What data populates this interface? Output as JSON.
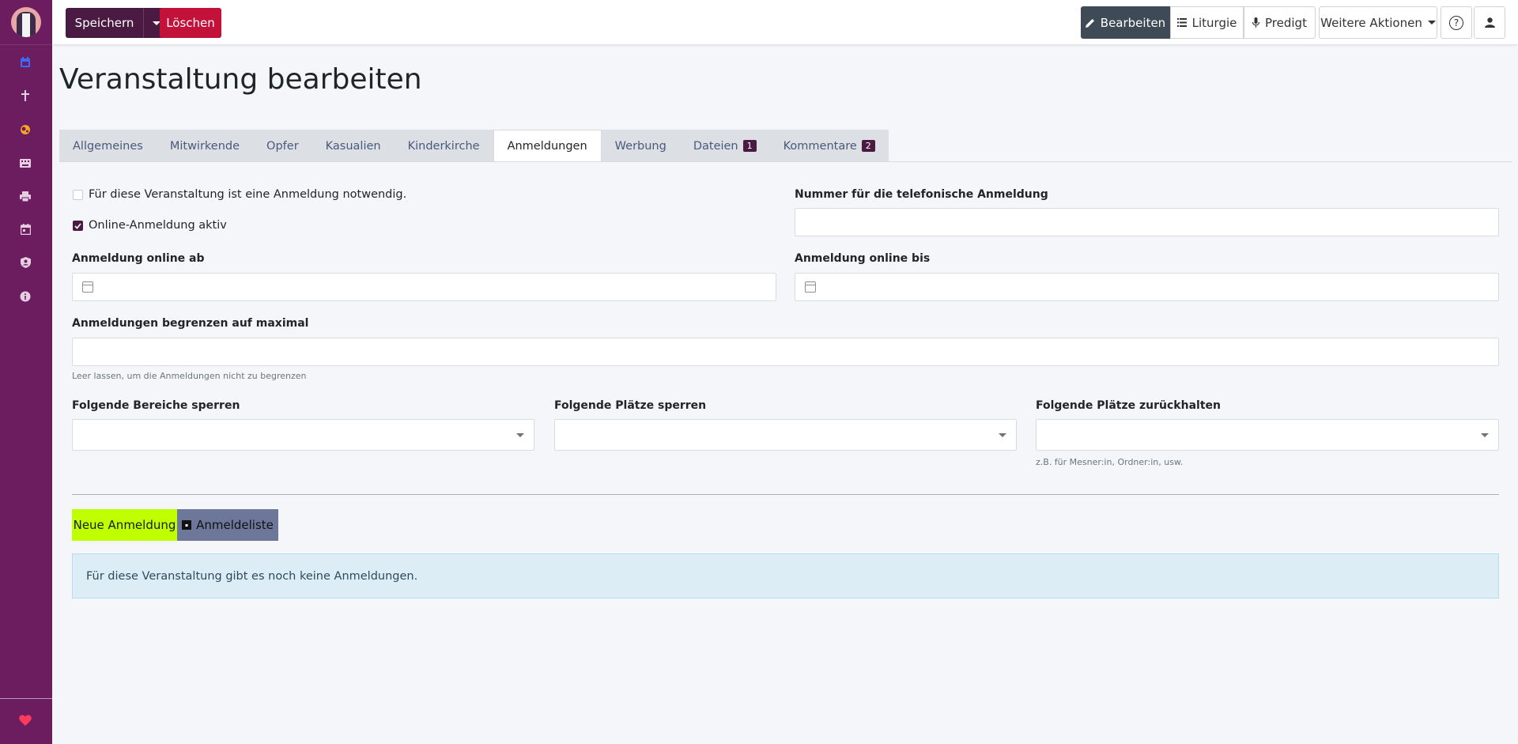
{
  "toolbar": {
    "save_label": "Speichern",
    "delete_label": "Löschen",
    "edit_label": "Bearbeiten",
    "liturgy_label": "Liturgie",
    "sermon_label": "Predigt",
    "more_label": "Weitere Aktionen"
  },
  "sidebar": {
    "icons": [
      "calendar-icon",
      "cross-icon",
      "globe-icon",
      "keyboard-icon",
      "print-icon",
      "calendar-day-icon",
      "user-shield-icon",
      "info-icon"
    ],
    "accent_color": "#6b1d5f",
    "footer_icon": "heart-icon"
  },
  "page": {
    "title": "Veranstaltung bearbeiten"
  },
  "tabs": [
    {
      "label": "Allgemeines"
    },
    {
      "label": "Mitwirkende"
    },
    {
      "label": "Opfer"
    },
    {
      "label": "Kasualien"
    },
    {
      "label": "Kinderkirche"
    },
    {
      "label": "Anmeldungen",
      "active": true
    },
    {
      "label": "Werbung"
    },
    {
      "label": "Dateien",
      "badge": "1"
    },
    {
      "label": "Kommentare",
      "badge": "2"
    }
  ],
  "form": {
    "registration_required_label": "Für diese Veranstaltung ist eine Anmeldung notwendig.",
    "registration_required_checked": false,
    "online_active_label": "Online-Anmeldung aktiv",
    "online_active_checked": true,
    "phone_label": "Nummer für die telefonische Anmeldung",
    "phone_value": "",
    "online_from_label": "Anmeldung online ab",
    "online_from_value": "",
    "online_until_label": "Anmeldung online bis",
    "online_until_value": "",
    "limit_label": "Anmeldungen begrenzen auf maximal",
    "limit_value": "",
    "limit_help": "Leer lassen, um die Anmeldungen nicht zu begrenzen",
    "block_areas_label": "Folgende Bereiche sperren",
    "block_seats_label": "Folgende Plätze sperren",
    "reserve_seats_label": "Folgende Plätze zurückhalten",
    "reserve_seats_help": "z.B. für Mesner:in, Ordner:in, usw."
  },
  "actions": {
    "new_registration_label": "Neue Anmeldung",
    "registration_list_label": "Anmeldeliste"
  },
  "alert": {
    "message": "Für diese Veranstaltung gibt es noch keine Anmeldungen."
  },
  "colors": {
    "primary": "#4a1a43",
    "danger": "#c3123a",
    "new_button": "#bfff00",
    "list_button": "#6c7799",
    "info_bg": "#dcedf5"
  }
}
